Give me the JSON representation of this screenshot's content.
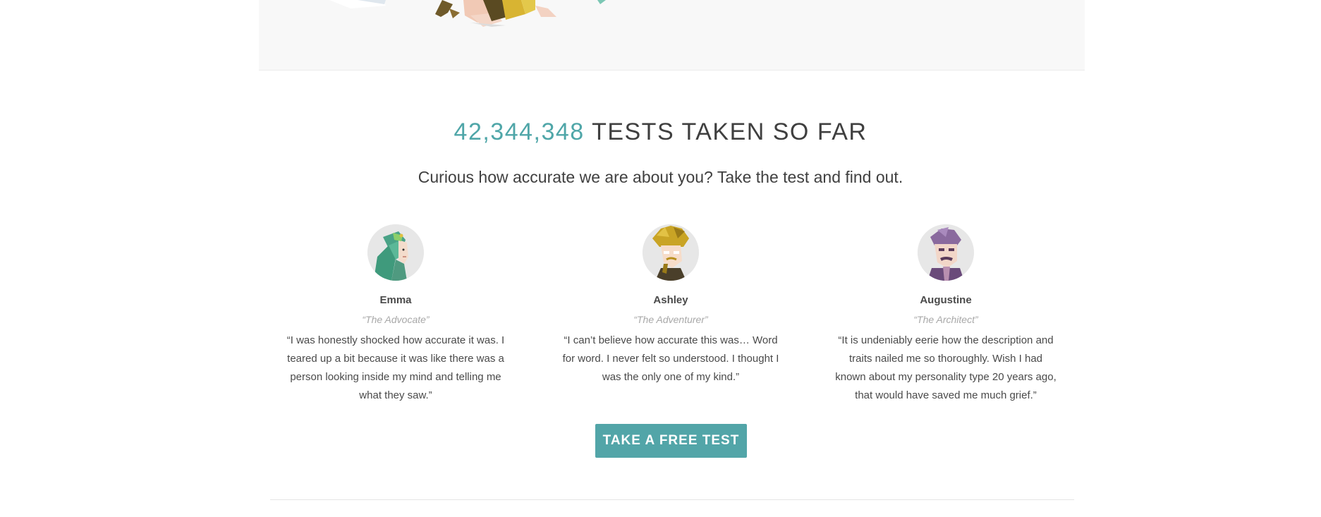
{
  "hero": {
    "illustration_icon": "personality-characters-illustration"
  },
  "stats": {
    "count": "42,344,348",
    "label": "TESTS TAKEN SO FAR",
    "accent_color": "#4fa6a8"
  },
  "subtitle": "Curious how accurate we are about you? Take the test and find out.",
  "testimonials": [
    {
      "name": "Emma",
      "type": "“The Advocate”",
      "quote": "“I was honestly shocked how accurate it was. I teared up a bit because it was like there was a person looking inside my mind and telling me what they saw.”",
      "avatar_icon": "advocate-avatar-icon"
    },
    {
      "name": "Ashley",
      "type": "“The Adventurer”",
      "quote": "“I can’t believe how accurate this was… Word for word. I never felt so understood. I thought I was the only one of my kind.”",
      "avatar_icon": "adventurer-avatar-icon"
    },
    {
      "name": "Augustine",
      "type": "“The Architect”",
      "quote": "“It is undeniably eerie how the description and traits nailed me so thoroughly. Wish I had known about my personality type 20 years ago, that would have saved me much grief.”",
      "avatar_icon": "architect-avatar-icon"
    }
  ],
  "cta": {
    "label": "TAKE A FREE TEST",
    "color": "#52a5a8"
  }
}
